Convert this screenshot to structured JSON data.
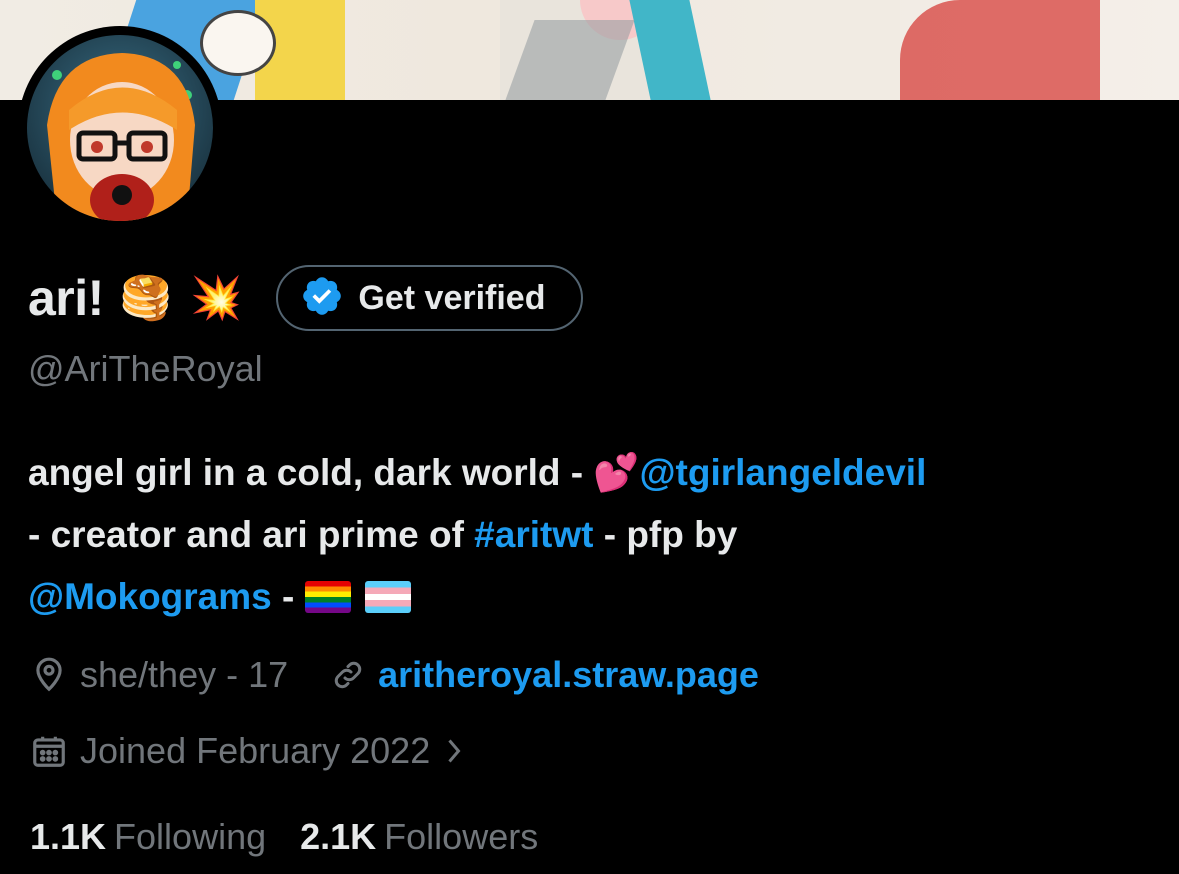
{
  "profile": {
    "display_name": "ari!",
    "name_emojis": [
      "🥞",
      "💥"
    ],
    "verify_label": "Get verified",
    "handle": "@AriTheRoyal",
    "bio": {
      "text1": "angel girl in a cold, dark world - ",
      "emoji_hearts": "💕",
      "mention1": "@tgirlangeldevil",
      "text2": " - creator and ari prime of ",
      "hashtag": "#aritwt",
      "text3": " - pfp by",
      "mention2": "@Mokograms",
      "text4": " - "
    },
    "location": "she/they - 17",
    "website": "aritheroyal.straw.page",
    "joined": "Joined February 2022",
    "following_count": "1.1K",
    "following_label": "Following",
    "followers_count": "2.1K",
    "followers_label": "Followers"
  },
  "icons": {
    "verify": "verified-badge-icon",
    "location": "location-pin-icon",
    "link": "link-icon",
    "calendar": "calendar-icon",
    "chevron": "chevron-right-icon"
  },
  "colors": {
    "background": "#000000",
    "text": "#e7e9ea",
    "secondary": "#71767b",
    "link": "#1d9bf0",
    "border": "#536471"
  }
}
